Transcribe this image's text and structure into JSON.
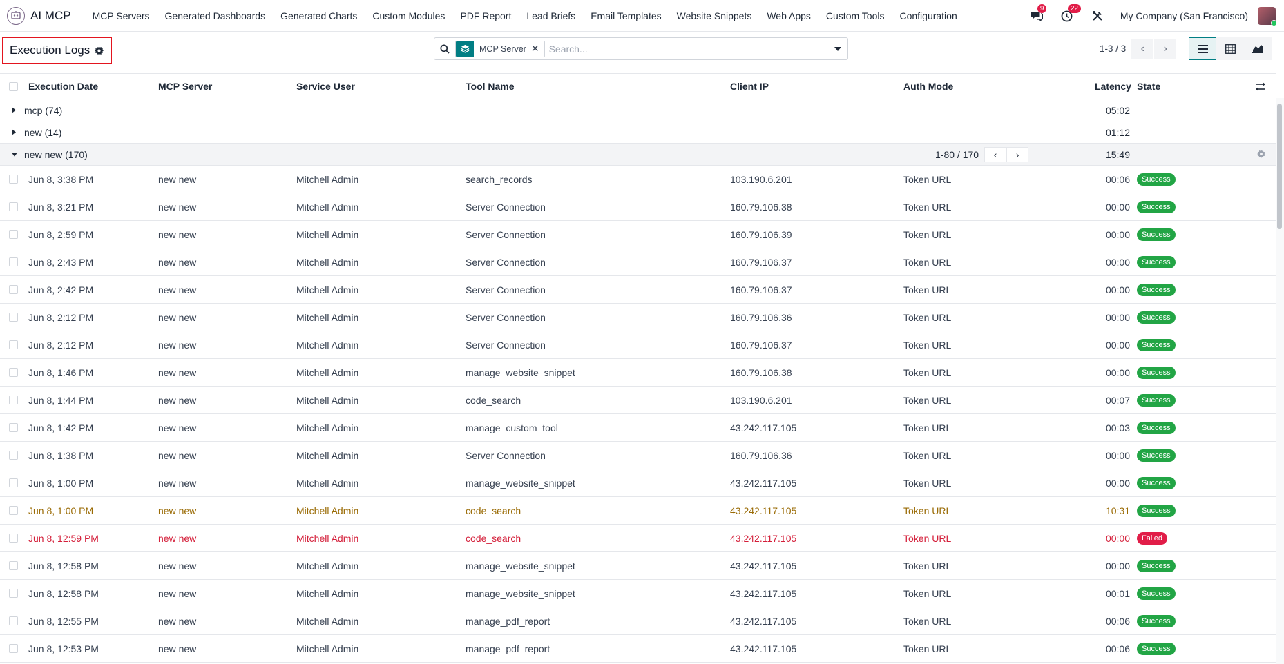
{
  "app": {
    "name": "AI MCP"
  },
  "nav": {
    "items": [
      "MCP Servers",
      "Generated Dashboards",
      "Generated Charts",
      "Custom Modules",
      "PDF Report",
      "Lead Briefs",
      "Email Templates",
      "Website Snippets",
      "Web Apps",
      "Custom Tools",
      "Configuration"
    ]
  },
  "systray": {
    "messages_count": "9",
    "activities_count": "22",
    "company": "My Company (San Francisco)"
  },
  "control": {
    "title": "Execution Logs",
    "facet": "MCP Server",
    "search_placeholder": "Search...",
    "pager": "1-3 / 3"
  },
  "table": {
    "columns": [
      "Execution Date",
      "MCP Server",
      "Service User",
      "Tool Name",
      "Client IP",
      "Auth Mode",
      "Latency",
      "State"
    ],
    "groups": [
      {
        "label": "mcp (74)",
        "latency": "05:02",
        "open": false
      },
      {
        "label": "new (14)",
        "latency": "01:12",
        "open": false
      },
      {
        "label": "new new (170)",
        "latency": "15:49",
        "open": true,
        "pager": "1-80 / 170"
      }
    ],
    "rows": [
      {
        "date": "Jun 8, 3:38 PM",
        "server": "new new",
        "user": "Mitchell Admin",
        "tool": "search_records",
        "ip": "103.190.6.201",
        "auth": "Token URL",
        "latency": "00:06",
        "state": "Success",
        "tone": "normal"
      },
      {
        "date": "Jun 8, 3:21 PM",
        "server": "new new",
        "user": "Mitchell Admin",
        "tool": "Server Connection",
        "ip": "160.79.106.38",
        "auth": "Token URL",
        "latency": "00:00",
        "state": "Success",
        "tone": "normal"
      },
      {
        "date": "Jun 8, 2:59 PM",
        "server": "new new",
        "user": "Mitchell Admin",
        "tool": "Server Connection",
        "ip": "160.79.106.39",
        "auth": "Token URL",
        "latency": "00:00",
        "state": "Success",
        "tone": "normal"
      },
      {
        "date": "Jun 8, 2:43 PM",
        "server": "new new",
        "user": "Mitchell Admin",
        "tool": "Server Connection",
        "ip": "160.79.106.37",
        "auth": "Token URL",
        "latency": "00:00",
        "state": "Success",
        "tone": "normal"
      },
      {
        "date": "Jun 8, 2:42 PM",
        "server": "new new",
        "user": "Mitchell Admin",
        "tool": "Server Connection",
        "ip": "160.79.106.37",
        "auth": "Token URL",
        "latency": "00:00",
        "state": "Success",
        "tone": "normal"
      },
      {
        "date": "Jun 8, 2:12 PM",
        "server": "new new",
        "user": "Mitchell Admin",
        "tool": "Server Connection",
        "ip": "160.79.106.36",
        "auth": "Token URL",
        "latency": "00:00",
        "state": "Success",
        "tone": "normal"
      },
      {
        "date": "Jun 8, 2:12 PM",
        "server": "new new",
        "user": "Mitchell Admin",
        "tool": "Server Connection",
        "ip": "160.79.106.37",
        "auth": "Token URL",
        "latency": "00:00",
        "state": "Success",
        "tone": "normal"
      },
      {
        "date": "Jun 8, 1:46 PM",
        "server": "new new",
        "user": "Mitchell Admin",
        "tool": "manage_website_snippet",
        "ip": "160.79.106.38",
        "auth": "Token URL",
        "latency": "00:00",
        "state": "Success",
        "tone": "normal"
      },
      {
        "date": "Jun 8, 1:44 PM",
        "server": "new new",
        "user": "Mitchell Admin",
        "tool": "code_search",
        "ip": "103.190.6.201",
        "auth": "Token URL",
        "latency": "00:07",
        "state": "Success",
        "tone": "normal"
      },
      {
        "date": "Jun 8, 1:42 PM",
        "server": "new new",
        "user": "Mitchell Admin",
        "tool": "manage_custom_tool",
        "ip": "43.242.117.105",
        "auth": "Token URL",
        "latency": "00:03",
        "state": "Success",
        "tone": "normal"
      },
      {
        "date": "Jun 8, 1:38 PM",
        "server": "new new",
        "user": "Mitchell Admin",
        "tool": "Server Connection",
        "ip": "160.79.106.36",
        "auth": "Token URL",
        "latency": "00:00",
        "state": "Success",
        "tone": "normal"
      },
      {
        "date": "Jun 8, 1:00 PM",
        "server": "new new",
        "user": "Mitchell Admin",
        "tool": "manage_website_snippet",
        "ip": "43.242.117.105",
        "auth": "Token URL",
        "latency": "00:00",
        "state": "Success",
        "tone": "normal"
      },
      {
        "date": "Jun 8, 1:00 PM",
        "server": "new new",
        "user": "Mitchell Admin",
        "tool": "code_search",
        "ip": "43.242.117.105",
        "auth": "Token URL",
        "latency": "10:31",
        "state": "Success",
        "tone": "warn"
      },
      {
        "date": "Jun 8, 12:59 PM",
        "server": "new new",
        "user": "Mitchell Admin",
        "tool": "code_search",
        "ip": "43.242.117.105",
        "auth": "Token URL",
        "latency": "00:00",
        "state": "Failed",
        "tone": "danger"
      },
      {
        "date": "Jun 8, 12:58 PM",
        "server": "new new",
        "user": "Mitchell Admin",
        "tool": "manage_website_snippet",
        "ip": "43.242.117.105",
        "auth": "Token URL",
        "latency": "00:00",
        "state": "Success",
        "tone": "normal"
      },
      {
        "date": "Jun 8, 12:58 PM",
        "server": "new new",
        "user": "Mitchell Admin",
        "tool": "manage_website_snippet",
        "ip": "43.242.117.105",
        "auth": "Token URL",
        "latency": "00:01",
        "state": "Success",
        "tone": "normal"
      },
      {
        "date": "Jun 8, 12:55 PM",
        "server": "new new",
        "user": "Mitchell Admin",
        "tool": "manage_pdf_report",
        "ip": "43.242.117.105",
        "auth": "Token URL",
        "latency": "00:06",
        "state": "Success",
        "tone": "normal"
      },
      {
        "date": "Jun 8, 12:53 PM",
        "server": "new new",
        "user": "Mitchell Admin",
        "tool": "manage_pdf_report",
        "ip": "43.242.117.105",
        "auth": "Token URL",
        "latency": "00:06",
        "state": "Success",
        "tone": "normal"
      }
    ]
  },
  "colors": {
    "accent": "#017e84",
    "success": "#22a545",
    "danger": "#e11d48",
    "warning_text": "#9a6b05",
    "highlight_border": "#e3151f"
  },
  "icons": [
    "app-logo-icon",
    "chat-icon",
    "clock-icon",
    "tools-icon",
    "gear-icon",
    "search-icon",
    "layers-icon",
    "close-icon",
    "caret-down-icon",
    "chevron-left-icon",
    "chevron-right-icon",
    "list-view-icon",
    "pivot-view-icon",
    "graph-view-icon",
    "column-settings-icon"
  ]
}
